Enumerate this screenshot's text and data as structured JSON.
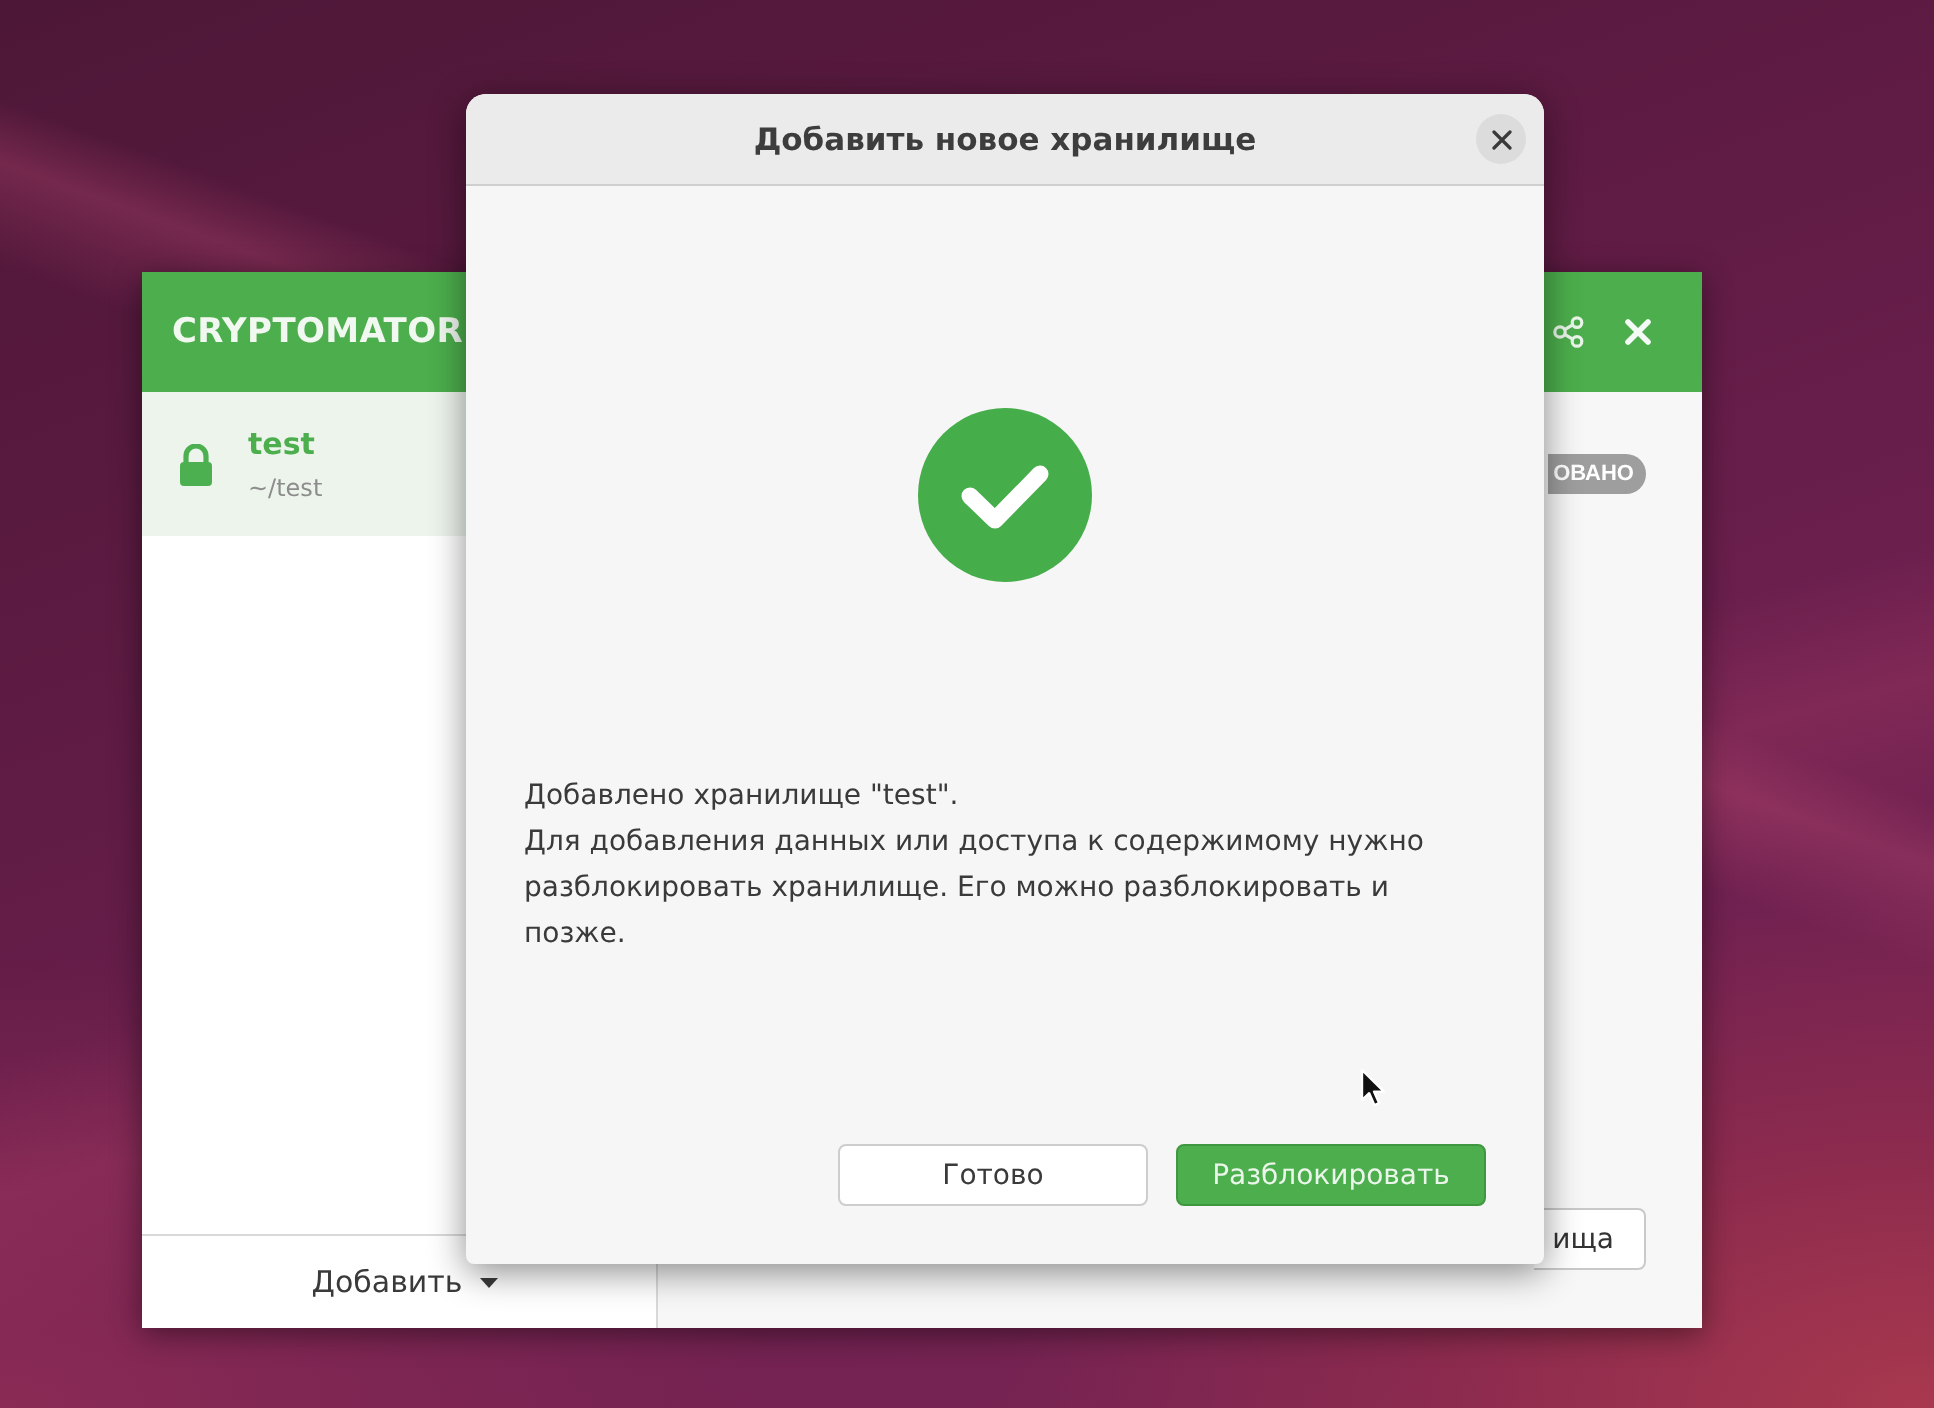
{
  "main_window": {
    "title": "CRYPTOMATOR",
    "vaults": [
      {
        "name": "test",
        "path": "~/test",
        "locked": true,
        "selected": true
      }
    ],
    "add_button": "Добавить",
    "status_badge": "ОВАНО",
    "action_button": "ища"
  },
  "dialog": {
    "title": "Добавить новое хранилище",
    "message": [
      "Добавлено хранилище \"test\".",
      "Для добавления данных или доступа к содержимому нужно разблокировать хранилище. Его можно разблокировать и позже."
    ],
    "buttons": [
      {
        "label": "Готово",
        "kind": "secondary"
      },
      {
        "label": "Разблокировать",
        "kind": "primary"
      }
    ]
  }
}
